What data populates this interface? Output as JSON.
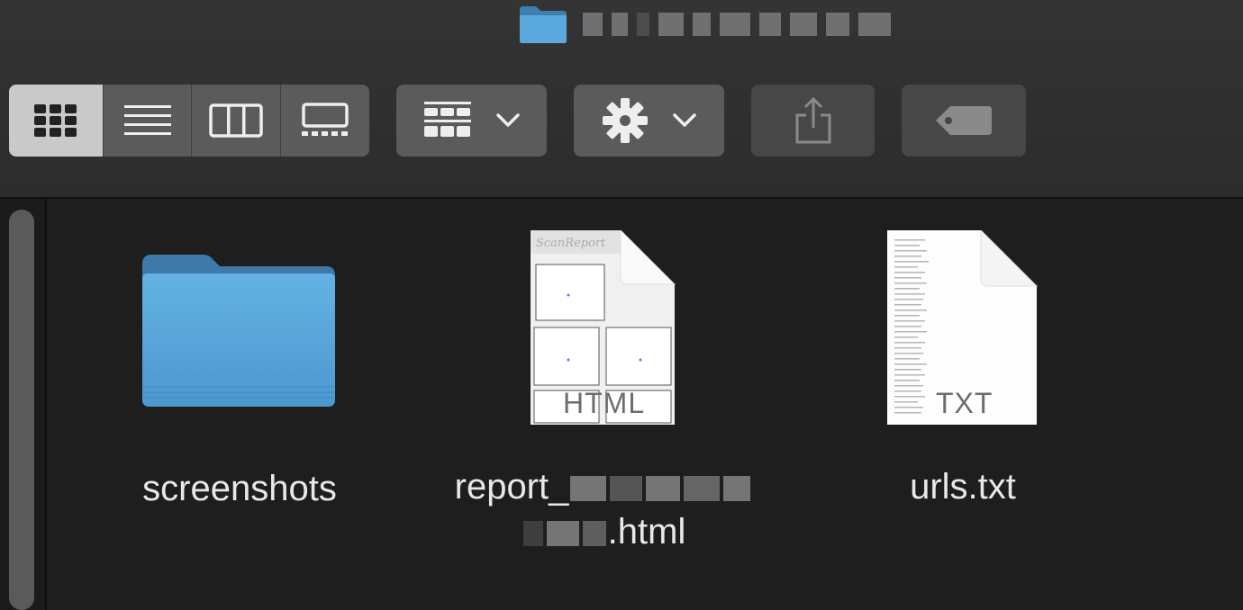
{
  "window": {
    "title": ""
  },
  "toolbar": {
    "view_modes": [
      {
        "name": "icon-view",
        "icon": "grid-icon",
        "active": true
      },
      {
        "name": "list-view",
        "icon": "list-icon",
        "active": false
      },
      {
        "name": "column-view",
        "icon": "columns-icon",
        "active": false
      },
      {
        "name": "gallery-view",
        "icon": "gallery-icon",
        "active": false
      }
    ],
    "group_button": {
      "icon": "group-icon",
      "dropdown_icon": "chevron-down-icon"
    },
    "action_button": {
      "icon": "gear-icon",
      "dropdown_icon": "chevron-down-icon"
    },
    "share_button": {
      "icon": "share-icon",
      "enabled": false
    },
    "tag_button": {
      "icon": "tag-icon",
      "enabled": false
    }
  },
  "files": [
    {
      "name": "screenshots",
      "kind": "folder",
      "icon": "folder-icon"
    },
    {
      "name_part1": "report_",
      "name_part2": ".html",
      "kind": "document",
      "badge": "HTML",
      "icon": "html-document-icon"
    },
    {
      "name": "urls.txt",
      "kind": "document",
      "badge": "TXT",
      "icon": "text-document-icon"
    }
  ],
  "colors": {
    "folder_blue": "#5aa8dc",
    "background": "#1e1e1e",
    "toolbar": "#2f2f2f"
  }
}
